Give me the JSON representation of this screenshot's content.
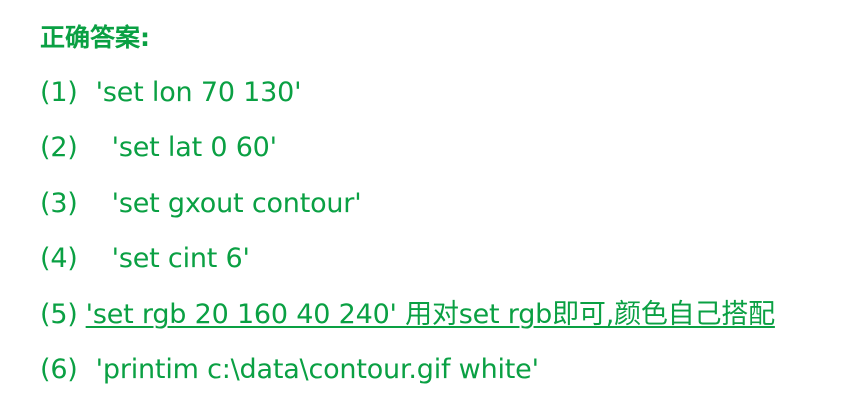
{
  "title": "正确答案:",
  "answers": [
    {
      "num": "(1)",
      "text": "'set lon 70 130'"
    },
    {
      "num": "(2)",
      "text": "'set lat 0 60'"
    },
    {
      "num": "(3)",
      "text": "'set gxout contour'"
    },
    {
      "num": "(4)",
      "text": "'set cint 6'"
    },
    {
      "num": "(5)",
      "text": "'set rgb 20 160 40 240' 用对set rgb即可,颜色自己搭配 "
    },
    {
      "num": "(6)",
      "text": "'printim c:\\data\\contour.gif white'"
    }
  ],
  "colors": {
    "text": "#0aa043",
    "background": "#ffffff"
  }
}
